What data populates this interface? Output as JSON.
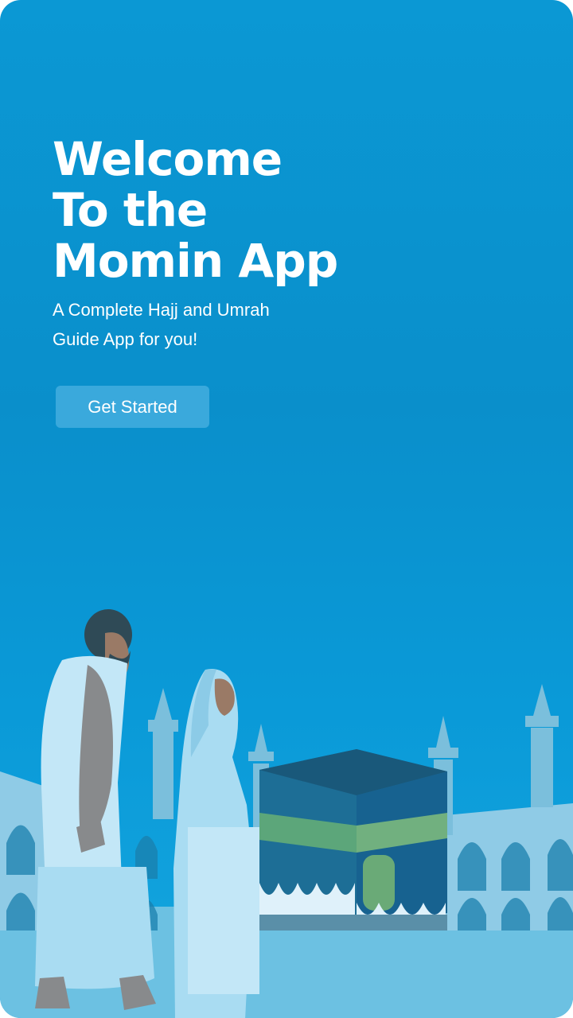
{
  "welcome": {
    "title_lines": [
      "Welcome",
      "To the",
      "Momin App"
    ],
    "subtitle_lines": [
      "A Complete Hajj and Umrah",
      "Guide App for you!"
    ],
    "cta_label": "Get Started"
  },
  "illustration": {
    "scene": "kaaba-with-pilgrims"
  },
  "colors": {
    "background": "#0a8fcb",
    "button": "#3aa9dc",
    "text": "#ffffff"
  }
}
